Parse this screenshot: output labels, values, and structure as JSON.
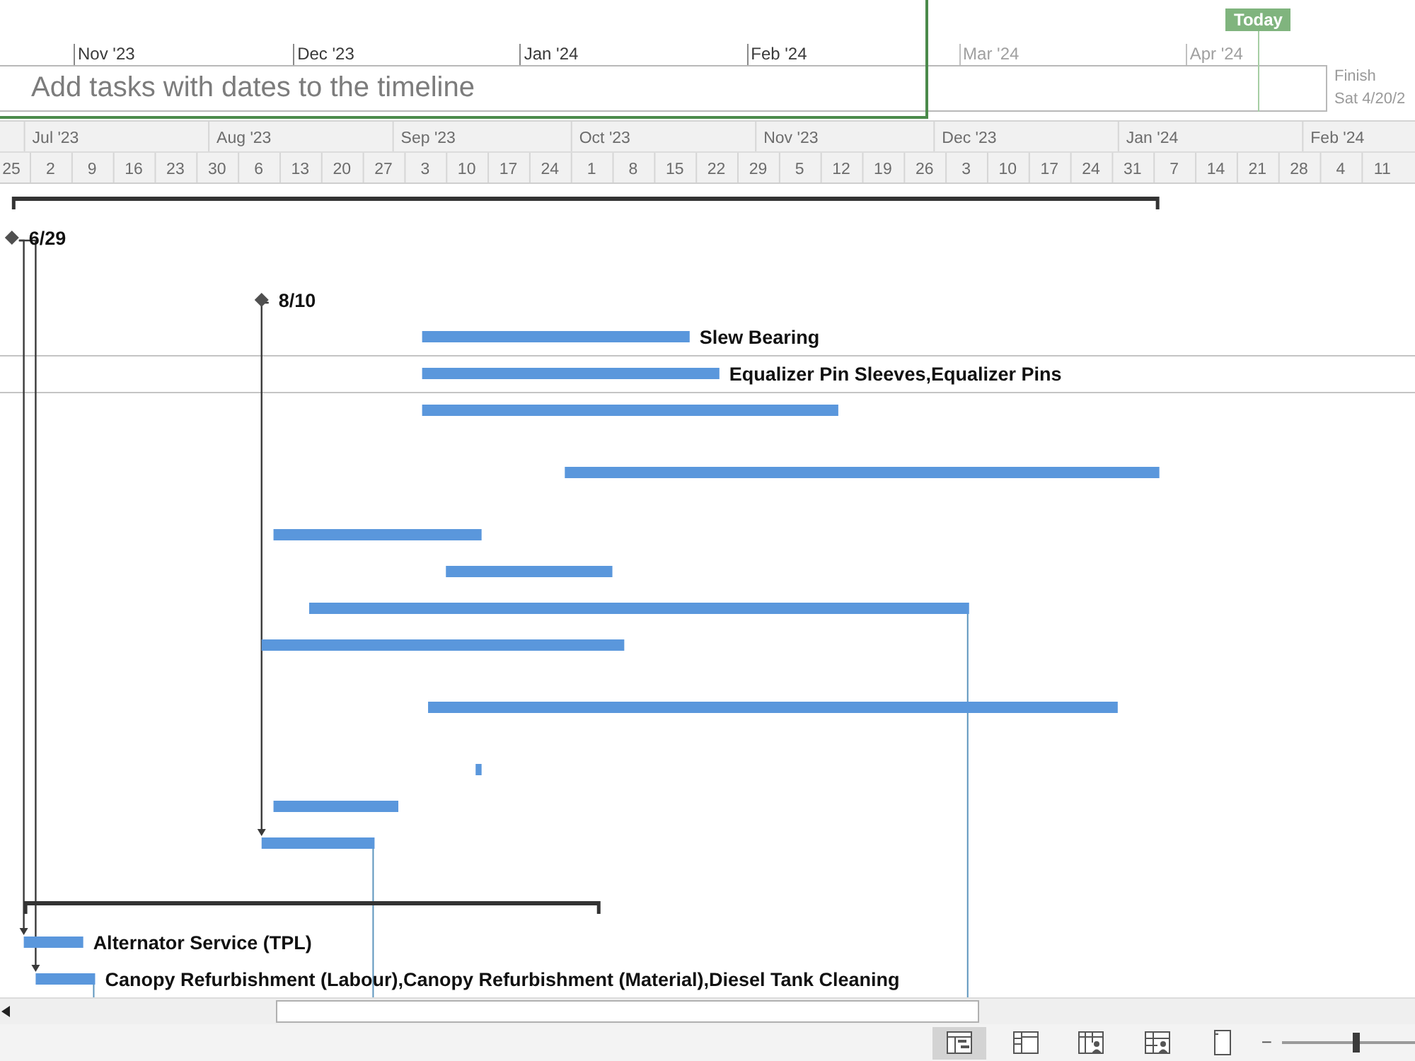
{
  "timeline": {
    "months": [
      {
        "label": "Nov '23",
        "in_range": true
      },
      {
        "label": "Dec '23",
        "in_range": true
      },
      {
        "label": "Jan '24",
        "in_range": true
      },
      {
        "label": "Feb '24",
        "in_range": true
      },
      {
        "label": "Mar '24",
        "in_range": false
      },
      {
        "label": "Apr '24",
        "in_range": false
      }
    ],
    "hint": "Add tasks with dates to the timeline",
    "today": "Today",
    "finish_label": "Finish",
    "finish_date": "Sat 4/20/2"
  },
  "gantt": {
    "months": [
      "Jul '23",
      "Aug '23",
      "Sep '23",
      "Oct '23",
      "Nov '23",
      "Dec '23",
      "Jan '24",
      "Feb '24"
    ],
    "weeks": [
      "25",
      "2",
      "9",
      "16",
      "23",
      "30",
      "6",
      "13",
      "20",
      "27",
      "3",
      "10",
      "17",
      "24",
      "1",
      "8",
      "15",
      "22",
      "29",
      "5",
      "12",
      "19",
      "26",
      "3",
      "10",
      "17",
      "24",
      "31",
      "7",
      "14",
      "21",
      "28",
      "4",
      "11"
    ],
    "rows": [
      {
        "kind": "summary",
        "selected": false
      },
      {
        "kind": "milestone",
        "label": "6/29",
        "selected": false
      },
      {
        "kind": "milestone",
        "label": "8/10",
        "selected": false
      },
      {
        "kind": "task",
        "label": "Slew Bearing",
        "selected": false
      },
      {
        "kind": "task",
        "label": "Equalizer Pin Sleeves,Equalizer Pins",
        "selected": true
      },
      {
        "kind": "task",
        "selected": false
      },
      {
        "kind": "task",
        "selected": false
      },
      {
        "kind": "task",
        "selected": false
      },
      {
        "kind": "task",
        "selected": false
      },
      {
        "kind": "task",
        "selected": false
      },
      {
        "kind": "task",
        "selected": false
      },
      {
        "kind": "task",
        "selected": false
      },
      {
        "kind": "task",
        "selected": false
      },
      {
        "kind": "task",
        "selected": false
      },
      {
        "kind": "task",
        "selected": false
      },
      {
        "kind": "summary",
        "selected": false
      },
      {
        "kind": "task",
        "label": "Alternator Service (TPL)",
        "selected": false
      },
      {
        "kind": "task",
        "label": "Canopy Refurbishment (Labour),Canopy Refurbishment (Material),Diesel Tank Cleaning",
        "selected": false
      }
    ]
  },
  "status_bar": {
    "views": [
      {
        "kind": "gantt",
        "selected": true
      },
      {
        "kind": "usage",
        "selected": false
      },
      {
        "kind": "planner",
        "selected": false
      },
      {
        "kind": "sheet",
        "selected": false
      },
      {
        "kind": "report",
        "selected": false
      }
    ],
    "zoom_out": "−",
    "zoom_slider": {
      "level": 0.52
    }
  }
}
